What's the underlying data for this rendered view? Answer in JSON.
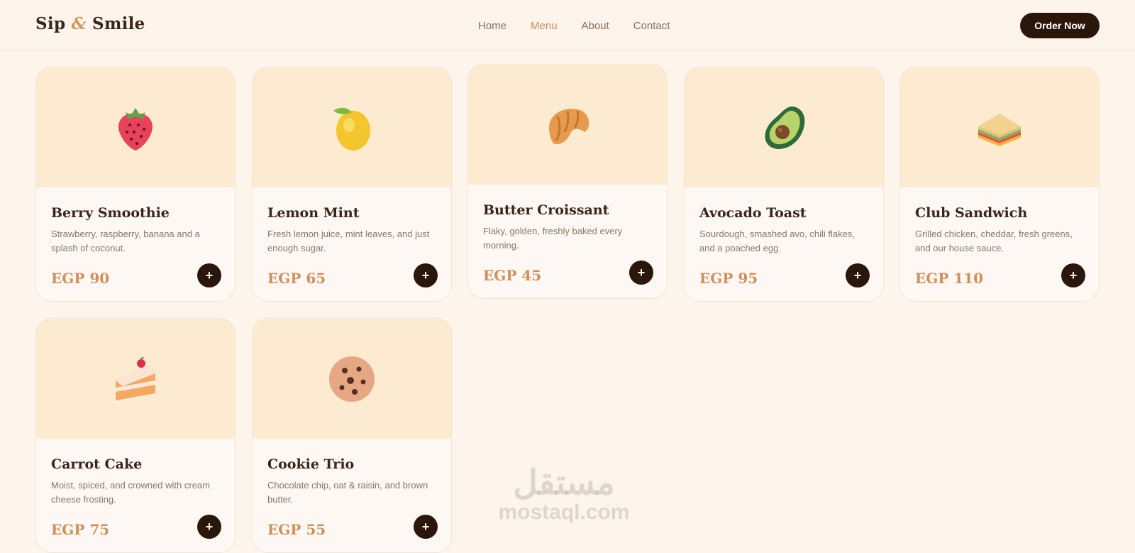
{
  "brand": {
    "part1": "Sip",
    "amp": "&",
    "part2": "Smile"
  },
  "nav": {
    "links": [
      "Home",
      "Menu",
      "About",
      "Contact"
    ],
    "active": "Menu"
  },
  "order_button": "Order Now",
  "colors": {
    "accent": "#cf8a52",
    "dark": "#2b160b",
    "hero_bg": "#fcebd0",
    "page_bg": "#fdf5ec"
  },
  "menu": [
    {
      "name": "Berry Smoothie",
      "description": "Strawberry, raspberry, banana and a splash of coconut.",
      "price": "EGP 90",
      "icon": "strawberry-icon"
    },
    {
      "name": "Lemon Mint",
      "description": "Fresh lemon juice, mint leaves, and just enough sugar.",
      "price": "EGP 65",
      "icon": "lemon-icon"
    },
    {
      "name": "Butter Croissant",
      "description": "Flaky, golden, freshly baked every morning.",
      "price": "EGP 45",
      "icon": "croissant-icon"
    },
    {
      "name": "Avocado Toast",
      "description": "Sourdough, smashed avo, chili flakes, and a poached egg.",
      "price": "EGP 95",
      "icon": "avocado-icon"
    },
    {
      "name": "Club Sandwich",
      "description": "Grilled chicken, cheddar, fresh greens, and our house sauce.",
      "price": "EGP 110",
      "icon": "sandwich-icon"
    },
    {
      "name": "Carrot Cake",
      "description": "Moist, spiced, and crowned with cream cheese frosting.",
      "price": "EGP 75",
      "icon": "cake-icon"
    },
    {
      "name": "Cookie Trio",
      "description": "Chocolate chip, oat & raisin, and brown butter.",
      "price": "EGP 55",
      "icon": "cookie-icon"
    }
  ],
  "add_symbol": "+",
  "watermark": {
    "arabic": "مستقل",
    "latin": "mostaql.com"
  }
}
